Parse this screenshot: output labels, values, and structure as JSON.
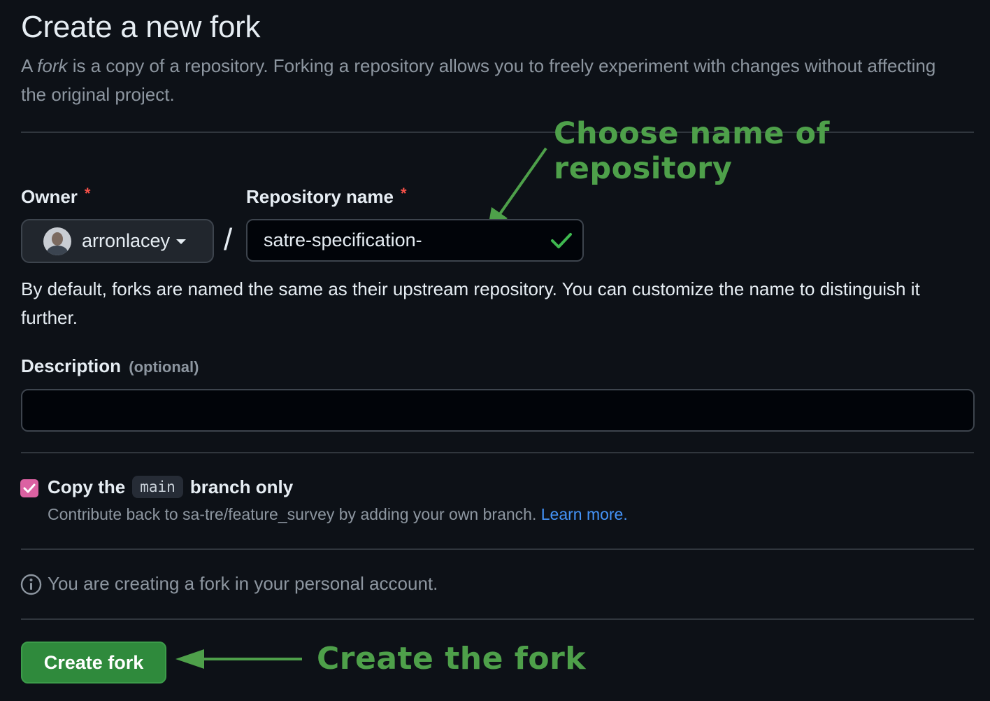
{
  "header": {
    "title": "Create a new fork",
    "subtitle_prefix": "A ",
    "subtitle_emph": "fork",
    "subtitle_rest": " is a copy of a repository. Forking a repository allows you to freely experiment with changes without affecting the original project."
  },
  "annotations": {
    "top": "Choose name of repository",
    "bottom": "Create the fork",
    "color": "#4ea04a"
  },
  "form": {
    "owner_label": "Owner",
    "repo_label": "Repository name",
    "required_mark": "*",
    "owner_value": "arronlacey",
    "separator": "/",
    "repo_value": "satre-specification-",
    "help_text": "By default, forks are named the same as their upstream repository. You can customize the name to distinguish it further.",
    "description_label": "Description",
    "description_optional": "(optional)",
    "description_value": "",
    "copy_prefix": "Copy the",
    "copy_branch": "main",
    "copy_suffix": "branch only",
    "copy_checked": true,
    "contrib_text": "Contribute back to sa-tre/feature_survey by adding your own branch.",
    "learn_more": "Learn more.",
    "info_text": "You are creating a fork in your personal account.",
    "submit_label": "Create fork"
  },
  "icons": {
    "avatar": "user-avatar",
    "caret": "triangle-down-icon",
    "valid": "check-icon",
    "checkbox": "checkbox-checked",
    "info": "info-icon"
  },
  "colors": {
    "background": "#0d1117",
    "accent_checkbox": "#db61a2",
    "primary_button": "#2f8a3c",
    "required": "#f85149",
    "link": "#4493f8"
  }
}
